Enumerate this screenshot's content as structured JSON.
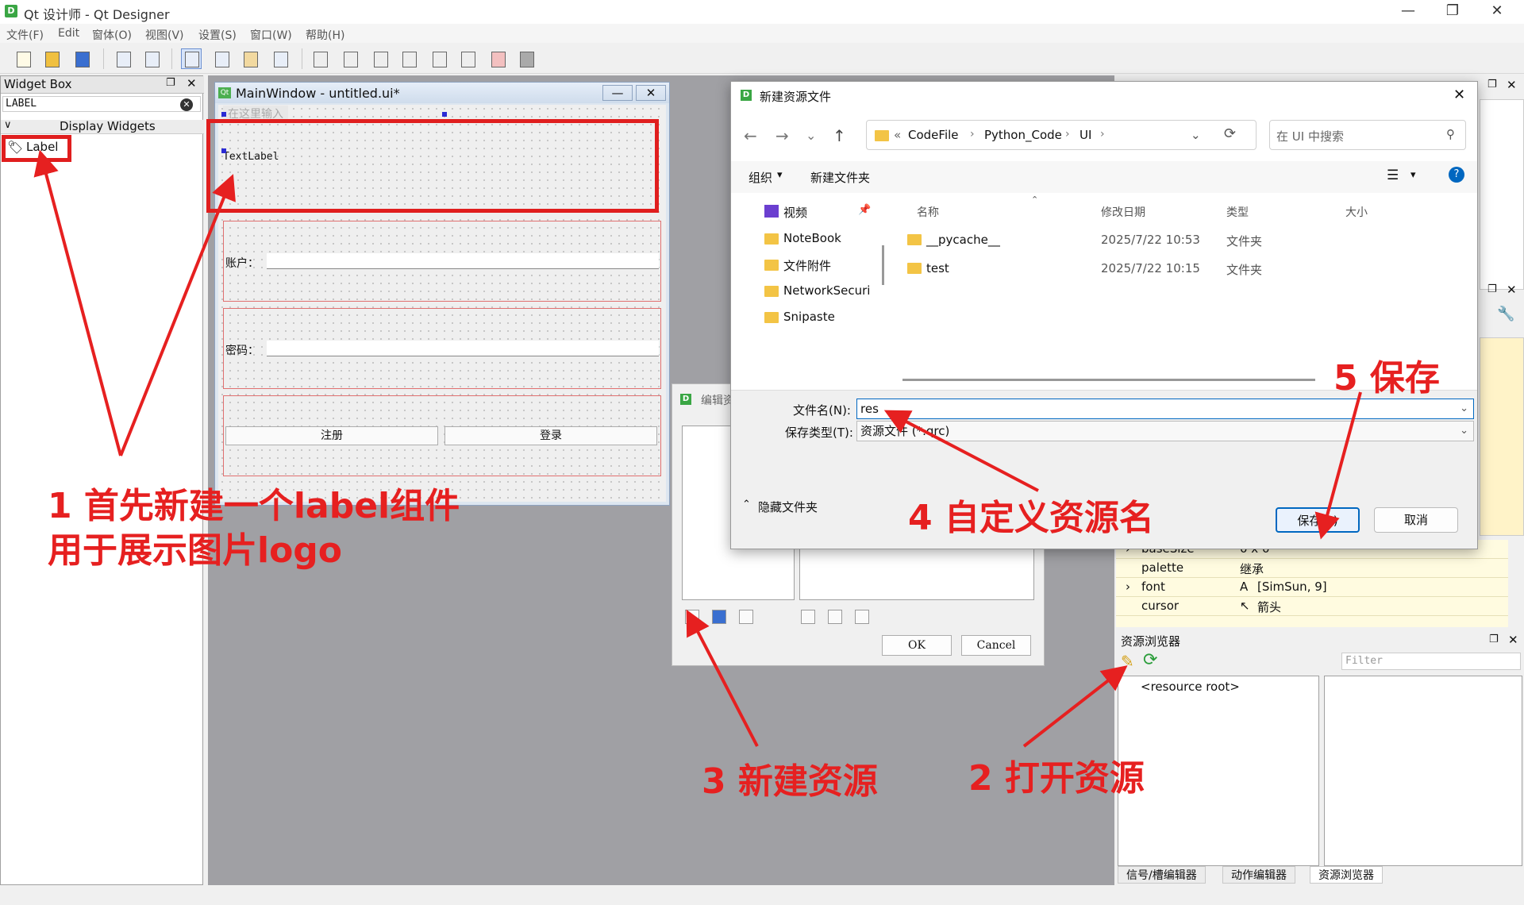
{
  "window": {
    "title": "Qt 设计师 - Qt Designer",
    "min_icon": "minimize-icon",
    "max_icon": "maximize-icon",
    "close_icon": "close-icon"
  },
  "menu": [
    "文件(F)",
    "Edit",
    "窗体(O)",
    "视图(V)",
    "设置(S)",
    "窗口(W)",
    "帮助(H)"
  ],
  "widget_box": {
    "title": "Widget Box",
    "filter_value": "LABEL",
    "category": "Display Widgets",
    "item_label": "Label"
  },
  "form": {
    "title": "MainWindow - untitled.ui*",
    "menu_placeholder": "在这里输入",
    "text_label": "TextLabel",
    "account_label": "账户：",
    "password_label": "密码：",
    "register_button": "注册",
    "login_button": "登录"
  },
  "save_dialog": {
    "title": "新建资源文件",
    "breadcrumb_prefix": "«",
    "breadcrumb": [
      "CodeFile",
      "Python_Code",
      "UI"
    ],
    "search_placeholder": "在 UI 中搜索",
    "organize": "组织",
    "new_folder": "新建文件夹",
    "nav": [
      "视频",
      "NoteBook",
      "文件附件",
      "NetworkSecuri",
      "Snipaste"
    ],
    "columns": [
      "名称",
      "修改日期",
      "类型",
      "大小"
    ],
    "files": [
      {
        "name": "__pycache__",
        "date": "2025/7/22 10:53",
        "type": "文件夹"
      },
      {
        "name": "test",
        "date": "2025/7/22 10:15",
        "type": "文件夹"
      }
    ],
    "filename_label": "文件名(N):",
    "filename_value": "res",
    "filetype_label": "保存类型(T):",
    "filetype_value": "资源文件 (*.qrc)",
    "hide_folders": "隐藏文件夹",
    "save_button": "保存(S)",
    "cancel_button": "取消"
  },
  "edit_resources": {
    "title": "编辑资",
    "ok": "OK",
    "cancel": "Cancel"
  },
  "property_rows": [
    {
      "name": "baseSize",
      "value": "0 x 0"
    },
    {
      "name": "palette",
      "value": "继承"
    },
    {
      "name": "font",
      "value": "[SimSun, 9]"
    },
    {
      "name": "cursor",
      "value": "箭头"
    }
  ],
  "resource_browser": {
    "title": "资源浏览器",
    "filter_placeholder": "Filter",
    "root": "<resource root>",
    "tabs": [
      "信号/槽编辑器",
      "动作编辑器",
      "资源浏览器"
    ]
  },
  "annotations": {
    "step1_line1": "1 首先新建一个label组件",
    "step1_line2": "用于展示图片logo",
    "step2": "2 打开资源",
    "step3": "3 新建资源",
    "step4": "4 自定义资源名",
    "step5": "5 保存"
  },
  "colors": {
    "annotation_red": "#e62020",
    "accent_blue": "#0067c0"
  }
}
